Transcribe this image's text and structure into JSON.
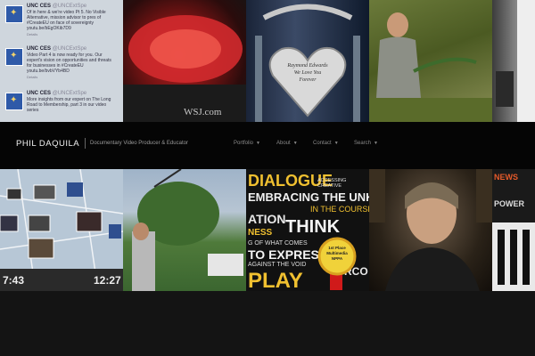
{
  "header": {
    "site_title": "PHIL DAQUILA",
    "tagline": "Documentary Video Producer & Educator",
    "nav": [
      {
        "label": "Portfolio"
      },
      {
        "label": "About"
      },
      {
        "label": "Contact"
      },
      {
        "label": "Search"
      }
    ]
  },
  "tweets": [
    {
      "name": "UNC CES",
      "handle": "@UNCExtSpe",
      "text": "Of in here & we're video Pt 5. No Visible Alternative, mission advisor to pres of #CreateEU on face of sovereignty youtu.be/bEgOKib7D9",
      "meta": "Details"
    },
    {
      "name": "UNC CES",
      "handle": "@UNCExtSpe",
      "text": "Video Part 4 is now ready for you. Our expert's vision on opportunities and threats for businesses in #CreateEU youtu.be/bvbVYb4BD",
      "meta": "Details"
    },
    {
      "name": "UNC CES",
      "handle": "@UNCExtSpe",
      "text": "More insights from our expert on The Long Road to Membership, part 3 in our video series",
      "meta": "Details"
    }
  ],
  "tile_text": {
    "wsj": "WSJ.com",
    "heart_line1": "Raymond Edwards",
    "heart_line2": "We Love You",
    "heart_line3": "Forever",
    "map_time_left": "7:43",
    "map_time_right": "12:27",
    "poster_lines": [
      "DIALOGUE",
      "ACCESSING CREATIVE",
      "EMBRACING THE UNKNO",
      "IN THE COURSE",
      "ATION",
      "THINK",
      "NESS",
      "G OF WHAT COMES",
      "TO EXPRESS",
      "AGAINST THE VOID",
      "PLAY",
      "RCO"
    ],
    "award_line1": "1st Place",
    "award_line2": "Multimedia",
    "award_line3": "NPPA",
    "news_label": "NEWS",
    "power_label": "POWER"
  },
  "colors": {
    "bar": "#050505",
    "background": "#141414",
    "title": "#f2f2f2",
    "nav": "#8a8a8a"
  }
}
